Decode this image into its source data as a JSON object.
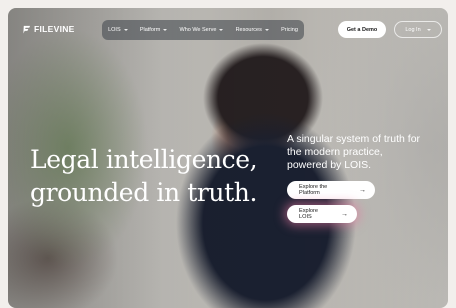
{
  "brand": {
    "name": "FILEVINE"
  },
  "nav": {
    "items": [
      {
        "label": "LOIS",
        "has_dropdown": true
      },
      {
        "label": "Platform",
        "has_dropdown": true
      },
      {
        "label": "Who We Serve",
        "has_dropdown": true
      },
      {
        "label": "Resources",
        "has_dropdown": true
      },
      {
        "label": "Pricing",
        "has_dropdown": false
      }
    ],
    "demo_label": "Get a Demo",
    "login_label": "Log In"
  },
  "hero": {
    "headline_line1": "Legal intelligence,",
    "headline_line2": "grounded in truth.",
    "tagline": "A singular system of truth for the modern practice, powered by LOIS.",
    "cta_platform": "Explore the Platform",
    "cta_lois": "Explore LOIS"
  },
  "icons": {
    "cta_arrow": "→"
  },
  "colors": {
    "text": "#ffffff",
    "button_bg": "#ffffff",
    "glow": "#e678a0"
  }
}
